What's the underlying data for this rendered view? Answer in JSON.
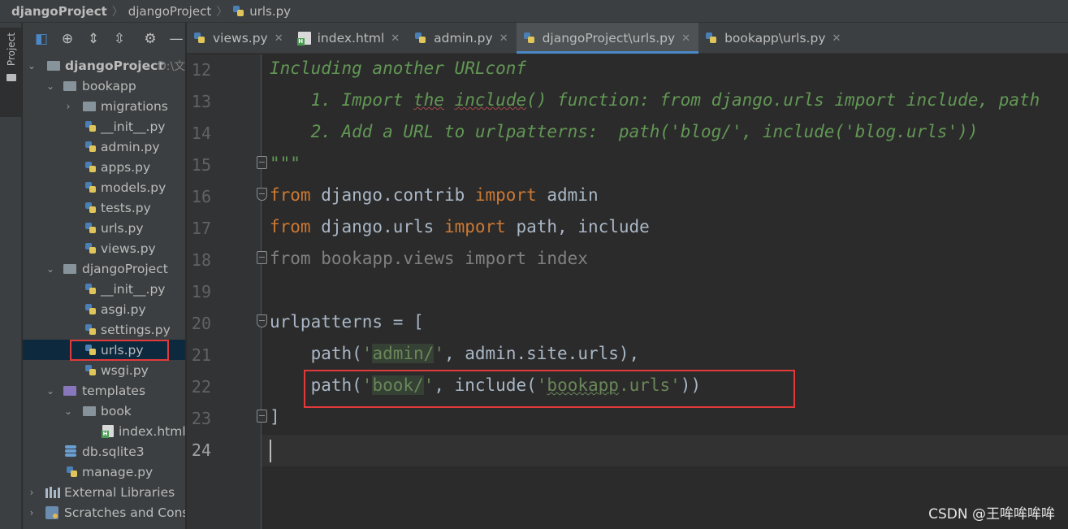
{
  "breadcrumb": [
    "djangoProject",
    "djangoProject",
    "urls.py"
  ],
  "left_stripe": {
    "project_label": "Project"
  },
  "project_panel": {
    "root_name": "djangoProject",
    "root_path": "D:\\文",
    "tree": [
      {
        "label": "djangoProject",
        "extra": "D:\\文"
      },
      {
        "label": "bookapp"
      },
      {
        "label": "migrations"
      },
      {
        "label": "__init__.py"
      },
      {
        "label": "admin.py"
      },
      {
        "label": "apps.py"
      },
      {
        "label": "models.py"
      },
      {
        "label": "tests.py"
      },
      {
        "label": "urls.py"
      },
      {
        "label": "views.py"
      },
      {
        "label": "djangoProject"
      },
      {
        "label": "__init__.py"
      },
      {
        "label": "asgi.py"
      },
      {
        "label": "settings.py"
      },
      {
        "label": "urls.py"
      },
      {
        "label": "wsgi.py"
      },
      {
        "label": "templates"
      },
      {
        "label": "book"
      },
      {
        "label": "index.html"
      },
      {
        "label": "db.sqlite3"
      },
      {
        "label": "manage.py"
      },
      {
        "label": "External Libraries"
      },
      {
        "label": "Scratches and Consoles"
      }
    ]
  },
  "tabs": [
    {
      "label": "views.py",
      "icon": "python-icon"
    },
    {
      "label": "index.html",
      "icon": "html-icon"
    },
    {
      "label": "admin.py",
      "icon": "python-icon"
    },
    {
      "label": "djangoProject\\urls.py",
      "icon": "python-icon",
      "active": true
    },
    {
      "label": "bookapp\\urls.py",
      "icon": "python-icon"
    }
  ],
  "editor": {
    "line_numbers": [
      "12",
      "13",
      "14",
      "15",
      "16",
      "17",
      "18",
      "19",
      "20",
      "21",
      "22",
      "23",
      "24"
    ],
    "lines": {
      "l12": "Including another URLconf",
      "l13a": "    1. Import ",
      "l13b": "the",
      "l13c": " ",
      "l13d": "include",
      "l13e": "() function: from django.urls import include, path",
      "l14": "    2. Add a URL to urlpatterns:  path('blog/', include('blog.urls'))",
      "l15": "\"\"\"",
      "l16_kw1": "from",
      "l16_mid": " django.contrib ",
      "l16_kw2": "import",
      "l16_end": " admin",
      "l17_kw1": "from",
      "l17_mid": " django.urls ",
      "l17_kw2": "import",
      "l17_end": " path, include",
      "l18": "from bookapp.views import index",
      "l20": "urlpatterns = [",
      "l21_a": "    path(",
      "l21_q1": "'",
      "l21_s": "admin/",
      "l21_q2": "'",
      "l21_b": ", admin.site.urls),",
      "l22_a": "    path(",
      "l22_q1": "'",
      "l22_s": "book/",
      "l22_q2": "'",
      "l22_b": ", include(",
      "l22_s2a": "'",
      "l22_s2b": "bookapp",
      "l22_s2c": ".urls'",
      "l22_c": "))",
      "l23": "]"
    }
  },
  "watermark": "CSDN @王哞哞哞哞",
  "colors": {
    "keyword": "#cc7832",
    "string": "#6a8759",
    "docstring": "#629755",
    "highlight_box": "#e23a3a",
    "selection": "#0d293e"
  }
}
